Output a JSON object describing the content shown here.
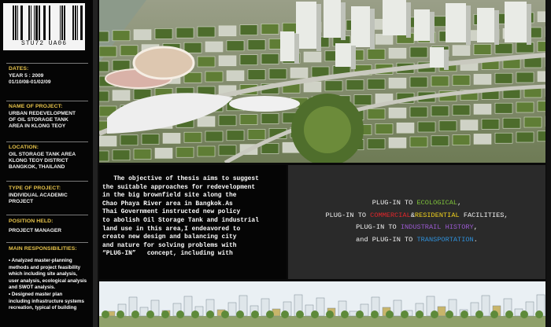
{
  "barcode": {
    "code": "STU72  UA06"
  },
  "sidebar": {
    "dates": {
      "heading": "DATES:",
      "lines": [
        "YEAR 5 : 2009",
        "01/10/08-01/02/09"
      ]
    },
    "project_name": {
      "heading": "NAME OF PROJECT:",
      "lines": [
        "URBAN REDEVELOPMENT",
        "OF OIL STORAGE TANK",
        "AREA IN KLONG TEOY"
      ]
    },
    "location": {
      "heading": "LOCATION:",
      "lines": [
        "OIL STORAGE TANK AREA",
        "KLONG TEOY DISTRICT",
        "BANGKOK, THAILAND"
      ]
    },
    "type": {
      "heading": "TYPE OF PROJECT:",
      "lines": [
        "INDIVIDUAL ACADEMIC",
        "PROJECT"
      ]
    },
    "position": {
      "heading": "POSITION HELD:",
      "lines": [
        "PROJECT MANAGER"
      ]
    },
    "responsibilities": {
      "heading": "MAIN RESPONSIBILITIES:",
      "lines": [
        "• Analyzed master-planning",
        "methods and project feasibility",
        "which including site analysis,",
        "user analysis, ecological analysis",
        "and SWOT analysis.",
        "• Designed master plan",
        "including infrastructure systems",
        "recreation, typical of building"
      ]
    }
  },
  "description": {
    "lines": [
      "   The objective of thesis aims to suggest",
      "the suitable approaches for redevelopment",
      "in the big brownfield site along the",
      "Chao Phaya River area in Bangkok.As",
      "Thai Government instructed new policy",
      "to abolish Oil Storage Tank and industrial",
      "land use in this area,I endeavored to",
      "create new design and balancing city",
      "and nature for solving problems with",
      "“PLUG-IN”   concept, including with"
    ]
  },
  "plugin": {
    "line1": {
      "prefix": "PLUG-IN TO ",
      "term": "ECOLOGICAL",
      "suffix": ","
    },
    "line2": {
      "prefix": "PLUG-IN TO ",
      "term1": "COMMERCIAL",
      "amp": "&",
      "term2": "RESIDENTIAL",
      "suffix": " FACILITIES,"
    },
    "line3": {
      "prefix": "PLUG-IN TO ",
      "term": "INDUSTRAIL HISTORY",
      "suffix": ","
    },
    "line4": {
      "prefix": "and PLUG-IN TO ",
      "term": "TRANSPORTATION",
      "suffix": "."
    }
  },
  "colors": {
    "heading": "#e8c44a",
    "ecological": "#7ec23a",
    "commercial": "#e2262b",
    "residential": "#f2d21c",
    "industrial": "#9b59d0",
    "transportation": "#2f8fd8"
  },
  "images": {
    "top": "aerial-masterplan-render",
    "bottom": "waterfront-elevation-render"
  }
}
